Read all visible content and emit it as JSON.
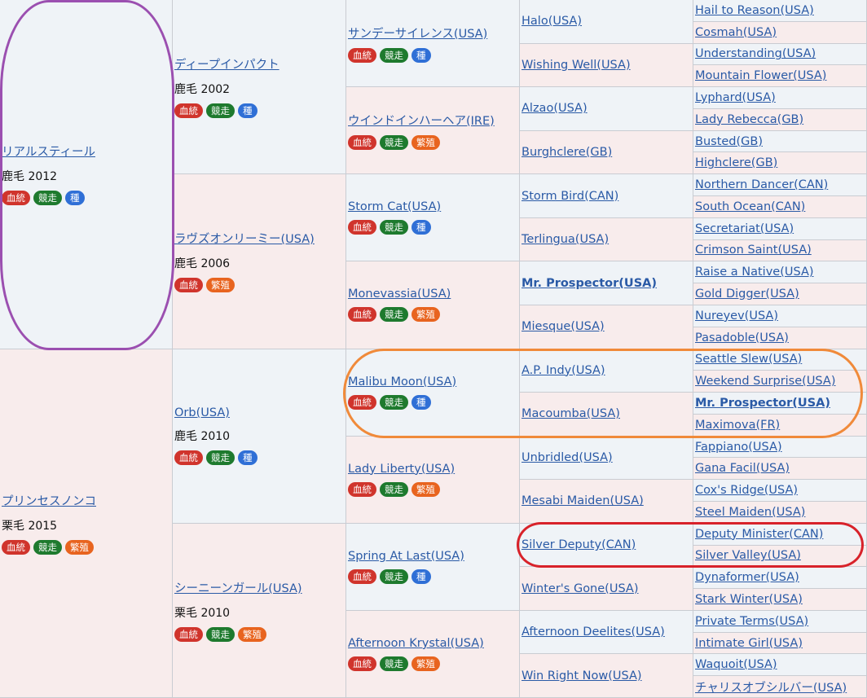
{
  "colors": {
    "link": "#2a5aa6",
    "male_bg": "#eff3f7",
    "female_bg": "#f8ecec",
    "badge_bloodline": "#d0342c",
    "badge_race": "#1e7a2e",
    "badge_stallion": "#2f6fd6",
    "badge_broodmare": "#e8641f",
    "ring_purple": "#9b4fb0",
    "ring_orange": "#f08a3a",
    "ring_red": "#d8222a"
  },
  "gen1": [
    {
      "name": "リアルスティール",
      "meta": "鹿毛 2012",
      "sex": "male",
      "badges": [
        "血統",
        "競走",
        "種"
      ]
    },
    {
      "name": "プリンセスノンコ",
      "meta": "栗毛 2015",
      "sex": "female",
      "badges": [
        "血統",
        "競走",
        "繁殖"
      ]
    }
  ],
  "gen2": [
    {
      "name": "ディープインパクト",
      "meta": "鹿毛 2002",
      "sex": "male",
      "badges": [
        "血統",
        "競走",
        "種"
      ]
    },
    {
      "name": "ラヴズオンリーミー(USA)",
      "meta": "鹿毛 2006",
      "sex": "female",
      "badges": [
        "血統",
        "繁殖"
      ]
    },
    {
      "name": "Orb(USA)",
      "meta": "鹿毛 2010",
      "sex": "male",
      "badges": [
        "血統",
        "競走",
        "種"
      ]
    },
    {
      "name": "シーニーンガール(USA)",
      "meta": "栗毛 2010",
      "sex": "female",
      "badges": [
        "血統",
        "競走",
        "繁殖"
      ]
    }
  ],
  "gen3": [
    {
      "name": "サンデーサイレンス(USA)",
      "sex": "male",
      "badges": [
        "血統",
        "競走",
        "種"
      ]
    },
    {
      "name": "ウインドインハーヘア(IRE)",
      "sex": "female",
      "badges": [
        "血統",
        "競走",
        "繁殖"
      ]
    },
    {
      "name": "Storm Cat(USA)",
      "sex": "male",
      "badges": [
        "血統",
        "競走",
        "種"
      ]
    },
    {
      "name": "Monevassia(USA)",
      "sex": "female",
      "badges": [
        "血統",
        "競走",
        "繁殖"
      ]
    },
    {
      "name": "Malibu Moon(USA)",
      "sex": "male",
      "badges": [
        "血統",
        "競走",
        "種"
      ]
    },
    {
      "name": "Lady Liberty(USA)",
      "sex": "female",
      "badges": [
        "血統",
        "競走",
        "繁殖"
      ]
    },
    {
      "name": "Spring At Last(USA)",
      "sex": "male",
      "badges": [
        "血統",
        "競走",
        "種"
      ]
    },
    {
      "name": "Afternoon Krystal(USA)",
      "sex": "female",
      "badges": [
        "血統",
        "競走",
        "繁殖"
      ]
    }
  ],
  "gen4": [
    {
      "name": "Halo(USA)",
      "sex": "male"
    },
    {
      "name": "Wishing Well(USA)",
      "sex": "female"
    },
    {
      "name": "Alzao(USA)",
      "sex": "male"
    },
    {
      "name": "Burghclere(GB)",
      "sex": "female"
    },
    {
      "name": "Storm Bird(CAN)",
      "sex": "male"
    },
    {
      "name": "Terlingua(USA)",
      "sex": "female"
    },
    {
      "name": "Mr. Prospector(USA)",
      "sex": "male",
      "bold": true
    },
    {
      "name": "Miesque(USA)",
      "sex": "female"
    },
    {
      "name": "A.P. Indy(USA)",
      "sex": "male"
    },
    {
      "name": "Macoumba(USA)",
      "sex": "female"
    },
    {
      "name": "Unbridled(USA)",
      "sex": "male"
    },
    {
      "name": "Mesabi Maiden(USA)",
      "sex": "female"
    },
    {
      "name": "Silver Deputy(CAN)",
      "sex": "male"
    },
    {
      "name": "Winter's Gone(USA)",
      "sex": "female"
    },
    {
      "name": "Afternoon Deelites(USA)",
      "sex": "male"
    },
    {
      "name": "Win Right Now(USA)",
      "sex": "female"
    }
  ],
  "gen5": [
    {
      "name": "Hail to Reason(USA)",
      "sex": "male"
    },
    {
      "name": "Cosmah(USA)",
      "sex": "female"
    },
    {
      "name": "Understanding(USA)",
      "sex": "male"
    },
    {
      "name": "Mountain Flower(USA)",
      "sex": "female"
    },
    {
      "name": "Lyphard(USA)",
      "sex": "male"
    },
    {
      "name": "Lady Rebecca(GB)",
      "sex": "female"
    },
    {
      "name": "Busted(GB)",
      "sex": "male"
    },
    {
      "name": "Highclere(GB)",
      "sex": "female"
    },
    {
      "name": "Northern Dancer(CAN)",
      "sex": "male"
    },
    {
      "name": "South Ocean(CAN)",
      "sex": "female"
    },
    {
      "name": "Secretariat(USA)",
      "sex": "male"
    },
    {
      "name": "Crimson Saint(USA)",
      "sex": "female"
    },
    {
      "name": "Raise a Native(USA)",
      "sex": "male"
    },
    {
      "name": "Gold Digger(USA)",
      "sex": "female"
    },
    {
      "name": "Nureyev(USA)",
      "sex": "male"
    },
    {
      "name": "Pasadoble(USA)",
      "sex": "female"
    },
    {
      "name": "Seattle Slew(USA)",
      "sex": "male"
    },
    {
      "name": "Weekend Surprise(USA)",
      "sex": "female"
    },
    {
      "name": "Mr. Prospector(USA)",
      "sex": "male",
      "bold": true
    },
    {
      "name": "Maximova(FR)",
      "sex": "female"
    },
    {
      "name": "Fappiano(USA)",
      "sex": "male"
    },
    {
      "name": "Gana Facil(USA)",
      "sex": "female"
    },
    {
      "name": "Cox's Ridge(USA)",
      "sex": "male"
    },
    {
      "name": "Steel Maiden(USA)",
      "sex": "female"
    },
    {
      "name": "Deputy Minister(CAN)",
      "sex": "male"
    },
    {
      "name": "Silver Valley(USA)",
      "sex": "female"
    },
    {
      "name": "Dynaformer(USA)",
      "sex": "male"
    },
    {
      "name": "Stark Winter(USA)",
      "sex": "female"
    },
    {
      "name": "Private Terms(USA)",
      "sex": "male"
    },
    {
      "name": "Intimate Girl(USA)",
      "sex": "female"
    },
    {
      "name": "Waquoit(USA)",
      "sex": "male"
    },
    {
      "name": "チャリスオブシルバー(USA)",
      "sex": "female"
    }
  ]
}
